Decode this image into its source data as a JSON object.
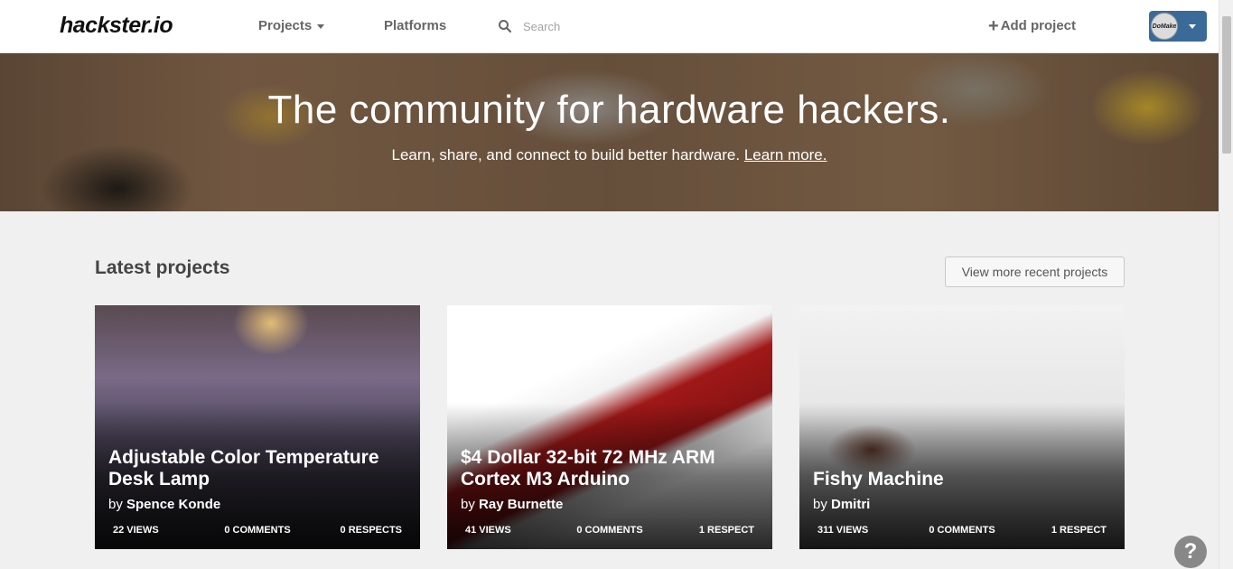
{
  "header": {
    "logo": "hackster.io",
    "nav": {
      "projects": "Projects",
      "platforms": "Platforms"
    },
    "search": {
      "placeholder": "Search"
    },
    "add_project": "Add project",
    "user": {
      "avatar_text": "DoMake"
    }
  },
  "hero": {
    "title": "The community for hardware hackers.",
    "subtitle": "Learn, share, and connect to build better hardware.",
    "learn_more": "Learn more."
  },
  "latest": {
    "title": "Latest projects",
    "view_more": "View more recent projects",
    "cards": [
      {
        "title": "Adjustable Color Temperature Desk Lamp",
        "by": "by",
        "author": "Spence Konde",
        "views": "22 VIEWS",
        "comments": "0 COMMENTS",
        "respects": "0 RESPECTS"
      },
      {
        "title": "$4 Dollar 32-bit 72 MHz ARM Cortex M3 Arduino",
        "by": "by",
        "author": "Ray Burnette",
        "views": "41 VIEWS",
        "comments": "0 COMMENTS",
        "respects": "1 RESPECT"
      },
      {
        "title": "Fishy Machine",
        "by": "by",
        "author": "Dmitri",
        "views": "311 VIEWS",
        "comments": "0 COMMENTS",
        "respects": "1 RESPECT"
      }
    ]
  },
  "help": {
    "label": "?"
  },
  "colors": {
    "user_menu": "#3a6a98",
    "nav_text": "#666666",
    "help_button": "#888888"
  }
}
